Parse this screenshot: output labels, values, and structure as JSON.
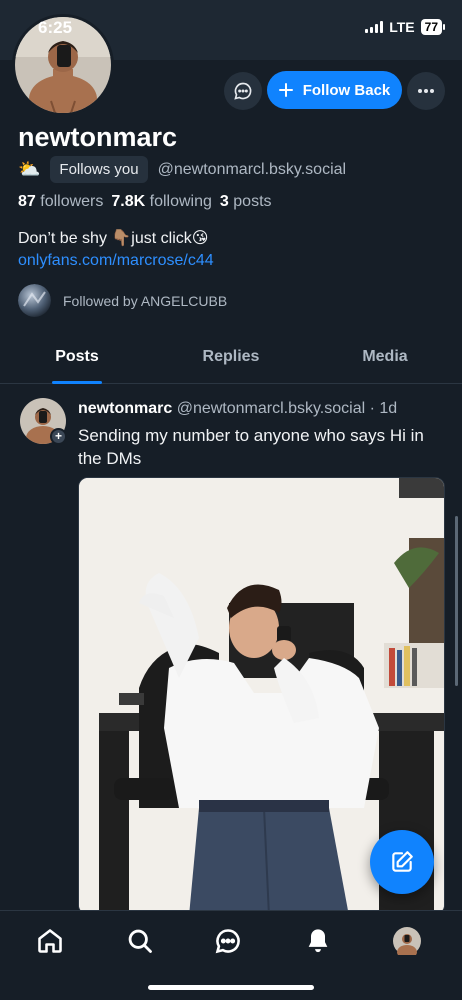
{
  "status_bar": {
    "time": "6:25",
    "network": "LTE",
    "battery": "77"
  },
  "profile": {
    "display_name": "newtonmarc",
    "weather_emoji": "⛅",
    "follows_you": "Follows you",
    "handle": "@newtonmarcl.bsky.social",
    "followers_count": "87",
    "followers_label": "followers",
    "following_count": "7.8K",
    "following_label": "following",
    "posts_count": "3",
    "posts_label": "posts",
    "bio_line": "Don’t be shy 👇🏽just click😘",
    "bio_link": "onlyfans.com/marcrose/c44",
    "followed_by": "Followed by ANGELCUBB"
  },
  "actions": {
    "follow_back": "Follow Back"
  },
  "tabs": [
    {
      "label": "Posts",
      "active": true
    },
    {
      "label": "Replies",
      "active": false
    },
    {
      "label": "Media",
      "active": false
    }
  ],
  "post": {
    "author": "newtonmarc",
    "handle": "@newtonmarcl.bsky.social",
    "separator": "·",
    "time": "1d",
    "text": "Sending my number to anyone who says Hi in the DMs"
  },
  "nav": [
    "home-icon",
    "search-icon",
    "chat-icon",
    "bell-icon",
    "profile-avatar"
  ],
  "colors": {
    "accent": "#1083fe",
    "background": "#161e27",
    "link": "#2e8fff"
  }
}
